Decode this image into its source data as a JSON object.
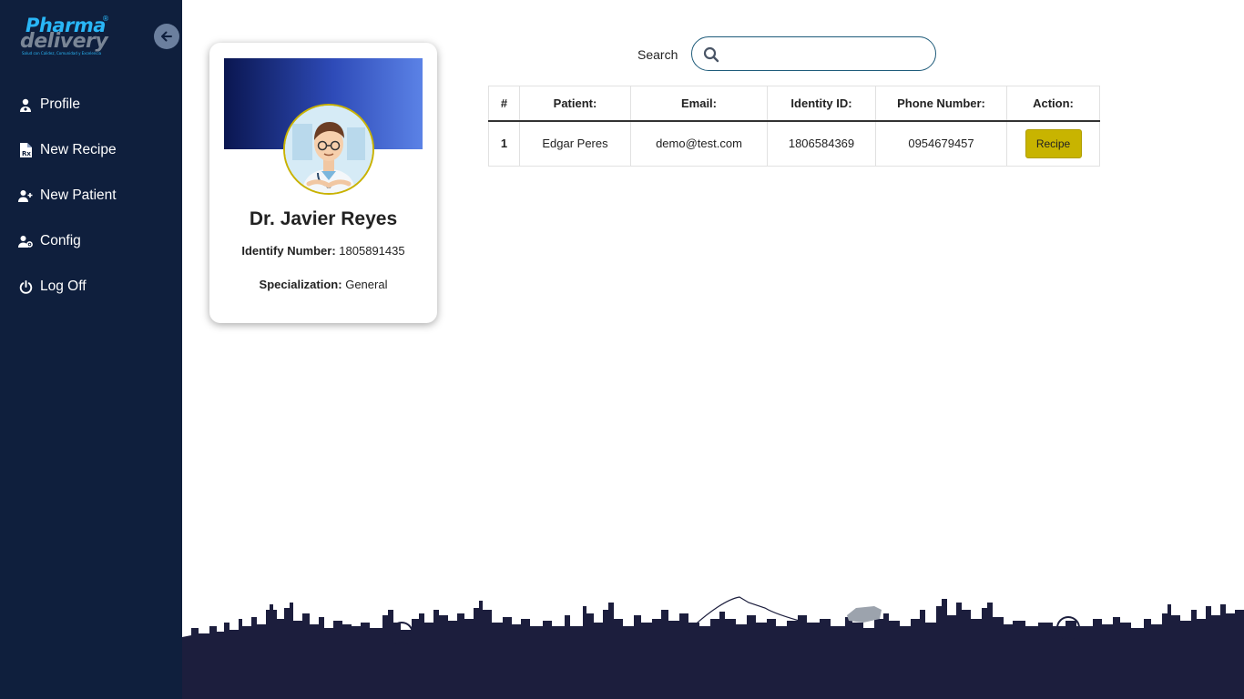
{
  "brand": {
    "line1": "Pharma",
    "line2": "delivery",
    "tagline": "Salud con Calidez, Comunidad y Excelencia"
  },
  "sidebar": {
    "items": [
      {
        "label": "Profile",
        "icon": "user-doctor-icon"
      },
      {
        "label": "New Recipe",
        "icon": "file-prescription-icon"
      },
      {
        "label": "New Patient",
        "icon": "user-plus-icon"
      },
      {
        "label": "Config",
        "icon": "user-gear-icon"
      },
      {
        "label": "Log Off",
        "icon": "power-icon"
      }
    ]
  },
  "profile": {
    "name": "Dr. Javier Reyes",
    "id_label": "Identify Number:",
    "id_value": "1805891435",
    "spec_label": "Specialization:",
    "spec_value": "General"
  },
  "search": {
    "label": "Search",
    "value": "",
    "placeholder": ""
  },
  "table": {
    "headers": [
      "#",
      "Patient:",
      "Email:",
      "Identity ID:",
      "Phone Number:",
      "Action:"
    ],
    "rows": [
      {
        "num": "1",
        "patient": "Edgar Peres",
        "email": "demo@test.com",
        "identity": "1806584369",
        "phone": "0954679457",
        "action": "Recipe"
      }
    ]
  },
  "colors": {
    "sidebar_bg": "#0f1f3d",
    "accent_button": "#c8b400",
    "banner_start": "#0a1650",
    "banner_end": "#5b82e6",
    "skyline": "#1c1e3d"
  }
}
